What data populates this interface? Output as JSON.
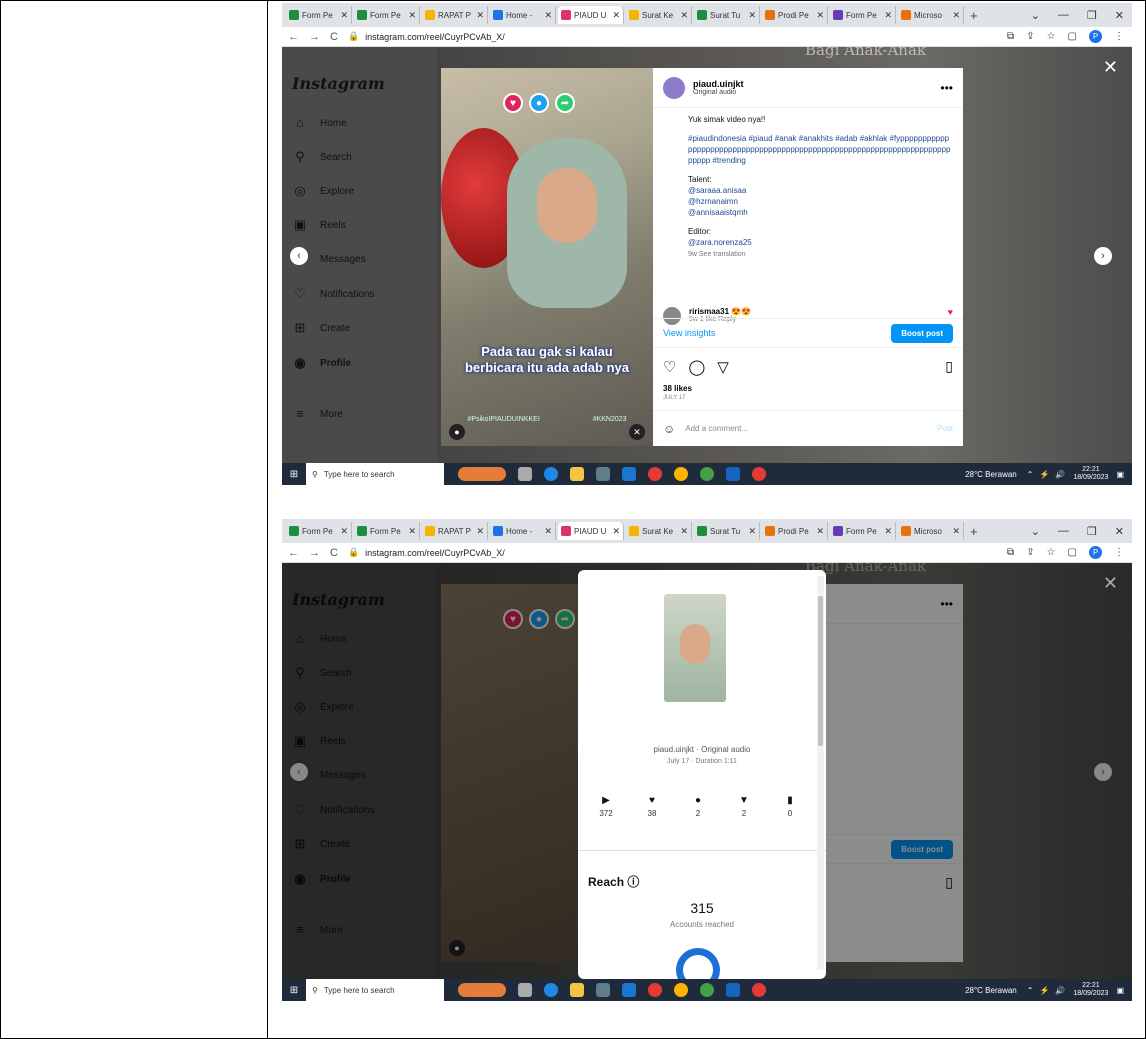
{
  "browser": {
    "tabs": [
      {
        "label": "Form Pe",
        "color": "#1e8e3e"
      },
      {
        "label": "Form Pe",
        "color": "#1e8e3e"
      },
      {
        "label": "RAPAT P",
        "color": "#f4b400"
      },
      {
        "label": "Home -",
        "color": "#1a73e8"
      },
      {
        "label": "PIAUD U",
        "color": "#e1306c",
        "active": true
      },
      {
        "label": "Surat Ke",
        "color": "#f4b400"
      },
      {
        "label": "Surat Tu",
        "color": "#1e8e3e"
      },
      {
        "label": "Prodi Pe",
        "color": "#e8710a"
      },
      {
        "label": "Form Pe",
        "color": "#673ab7"
      },
      {
        "label": "Microso",
        "color": "#e8710a"
      }
    ],
    "url": "instagram.com/reel/CuyrPCvAb_X/",
    "profile_initial": "P"
  },
  "sidebar": {
    "logo": "Instagram",
    "items": [
      {
        "label": "Home",
        "icon": "home-icon",
        "glyph": "⌂"
      },
      {
        "label": "Search",
        "icon": "search-icon",
        "glyph": "⚲"
      },
      {
        "label": "Explore",
        "icon": "compass-icon",
        "glyph": "◎"
      },
      {
        "label": "Reels",
        "icon": "reels-icon",
        "glyph": "▣"
      },
      {
        "label": "Messages",
        "icon": "messenger-icon",
        "glyph": "✉"
      },
      {
        "label": "Notifications",
        "icon": "heart-icon",
        "glyph": "♡"
      },
      {
        "label": "Create",
        "icon": "plus-icon",
        "glyph": "⊞"
      },
      {
        "label": "Profile",
        "icon": "avatar-icon",
        "glyph": "◉"
      },
      {
        "label": "More",
        "icon": "menu-icon",
        "glyph": "≡"
      }
    ]
  },
  "background_title": "Bagi Anak-Anak",
  "video": {
    "caption_line1": "Pada tau gak si kalau",
    "caption_line2": "berbicara itu ada adab nya",
    "tag_left": "#PsikoIPIAUDUINKKEI",
    "tag_right": "#KKN2023"
  },
  "post": {
    "username": "piaud.uinjkt",
    "audio": "Original audio",
    "intro": "Yuk simak video nya!!",
    "hashtags": "#piaudindonesia #piaud #anak #anakhits #adab #akhlak #fyppppppppppppppppppppppppppppppppppppppppppppppppppppppppppppppppppppppppppp #trending",
    "talent_label": "Talent:",
    "talents": [
      "@saraaa.anisaa",
      "@hzrnanaimn",
      "@annisaaistqmh"
    ],
    "editor_label": "Editor:",
    "editor": "@zara.norenza25",
    "caption_meta": "9w   See translation",
    "comment_user": "rirismaa31 😍😍",
    "comment_meta": "9w   1 like   Reply",
    "view_insights": "View insights",
    "boost_post": "Boost post",
    "likes": "38 likes",
    "date": "JULY 17",
    "add_comment": "Add a comment...",
    "post_btn": "Post"
  },
  "insights_modal": {
    "audio": "piaud.uinjkt · Original audio",
    "date_duration": "July 17 · Duration 1:11",
    "stats": [
      {
        "icon": "play-icon",
        "glyph": "▶",
        "value": "372"
      },
      {
        "icon": "heart-icon",
        "glyph": "♥",
        "value": "38"
      },
      {
        "icon": "comment-icon",
        "glyph": "●",
        "value": "2"
      },
      {
        "icon": "share-icon",
        "glyph": "▼",
        "value": "2"
      },
      {
        "icon": "bookmark-icon",
        "glyph": "▮",
        "value": "0"
      }
    ],
    "reach_title": "Reach ⓘ",
    "reach_value": "315",
    "reach_label": "Accounts reached"
  },
  "taskbar": {
    "search_placeholder": "Type here to search",
    "weather": "28°C  Berawan",
    "time": "22:21",
    "date": "18/09/2023",
    "time2": "22:21"
  }
}
